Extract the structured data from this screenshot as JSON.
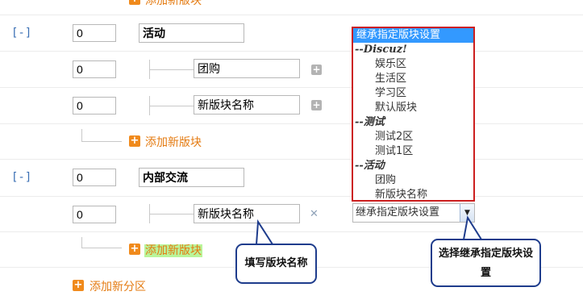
{
  "top_partial": {
    "add_block_label": "添加新版块"
  },
  "groups": [
    {
      "toggle": "[-]",
      "order": "0",
      "name": "活动",
      "blocks": [
        {
          "order": "0",
          "name": "团购"
        },
        {
          "order": "0",
          "name": "新版块名称"
        }
      ],
      "add_block_label": "添加新版块"
    },
    {
      "toggle": "[-]",
      "order": "0",
      "name": "内部交流",
      "blocks": [
        {
          "order": "0",
          "name": "新版块名称"
        }
      ],
      "add_block_label": "添加新版块"
    }
  ],
  "add_category_label": "添加新分区",
  "inherit_select": {
    "selected": "继承指定版块设置",
    "options": [
      {
        "kind": "selected",
        "label": "继承指定版块设置"
      },
      {
        "kind": "group",
        "label": "--Discuz!"
      },
      {
        "kind": "option",
        "label": "娱乐区"
      },
      {
        "kind": "option",
        "label": "生活区"
      },
      {
        "kind": "option",
        "label": "学习区"
      },
      {
        "kind": "option",
        "label": "默认版块"
      },
      {
        "kind": "group",
        "label": "--测试"
      },
      {
        "kind": "option",
        "label": "测试2区"
      },
      {
        "kind": "option",
        "label": "测试1区"
      },
      {
        "kind": "group",
        "label": "--活动"
      },
      {
        "kind": "option",
        "label": "团购"
      },
      {
        "kind": "option",
        "label": "新版块名称"
      }
    ]
  },
  "callouts": {
    "fill_name": "填写版块名称",
    "select_inherit": "选择继承指定版块设置"
  },
  "colors": {
    "accent_orange": "#e47b12",
    "link_blue": "#3a6fb4",
    "dropdown_border": "#cc1f1f",
    "selected_blue": "#3399ff",
    "highlight_green": "#b9f59a",
    "callout_border": "#1e3c8c"
  }
}
